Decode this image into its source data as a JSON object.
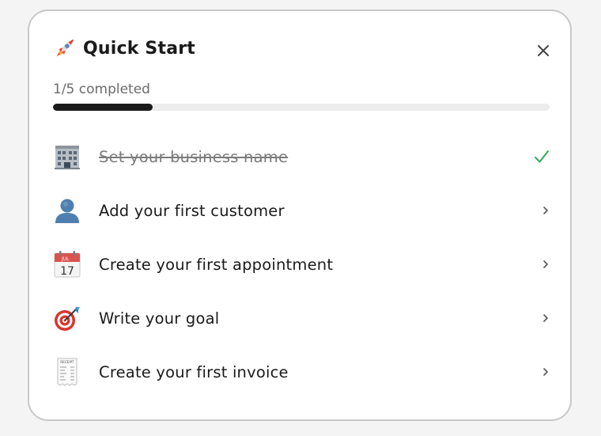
{
  "panel": {
    "title": "Quick Start",
    "progress": {
      "text": "1/5 completed",
      "completed": 1,
      "total": 5
    },
    "icons": {
      "header": "rocket-icon",
      "close": "close-icon"
    }
  },
  "tasks": [
    {
      "label": "Set your business name",
      "done": true,
      "icon": "building-icon"
    },
    {
      "label": "Add your first customer",
      "done": false,
      "icon": "person-silhouette-icon"
    },
    {
      "label": "Create your first appointment",
      "done": false,
      "icon": "calendar-icon"
    },
    {
      "label": "Write your goal",
      "done": false,
      "icon": "target-icon"
    },
    {
      "label": "Create your first invoice",
      "done": false,
      "icon": "receipt-icon"
    }
  ],
  "calendar": {
    "month": "JUL",
    "day": "17"
  },
  "receipt": {
    "heading": "RECEIPT"
  },
  "colors": {
    "check": "#34a853",
    "progress_fill": "#1b1b1b",
    "progress_track": "#ececec"
  }
}
